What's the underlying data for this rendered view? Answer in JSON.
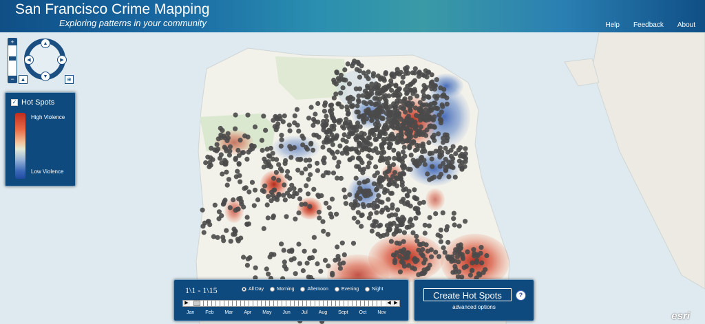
{
  "header": {
    "title": "San Francisco Crime Mapping",
    "subtitle": "Exploring patterns in your community",
    "links": [
      "Help",
      "Feedback",
      "About"
    ]
  },
  "legend": {
    "checkbox_checked": true,
    "title": "Hot Spots",
    "high_label": "High Violence",
    "low_label": "Low Violence",
    "high_color": "#c02c1f",
    "low_color": "#1f4aa0"
  },
  "time_panel": {
    "range": "1\\1 - 1\\15",
    "options": [
      {
        "label": "All Day",
        "selected": true
      },
      {
        "label": "Morning",
        "selected": false
      },
      {
        "label": "Afternoon",
        "selected": false
      },
      {
        "label": "Evening",
        "selected": false
      },
      {
        "label": "Night",
        "selected": false
      }
    ],
    "months": [
      "Jan",
      "Feb",
      "Mar",
      "Apr",
      "May",
      "Jun",
      "Jul",
      "Aug",
      "Sept",
      "Oct",
      "Nov"
    ]
  },
  "hot_spot_panel": {
    "button_label": "Create Hot Spots",
    "help_glyph": "?",
    "advanced_label": "advanced options"
  },
  "map_logo": "esri",
  "colors": {
    "panel_bg": "#0e4a7e",
    "header_bg": "#1a5e96",
    "water": "#dfeaf0",
    "land": "#f3f1ea",
    "points": "#4a4a4a"
  }
}
